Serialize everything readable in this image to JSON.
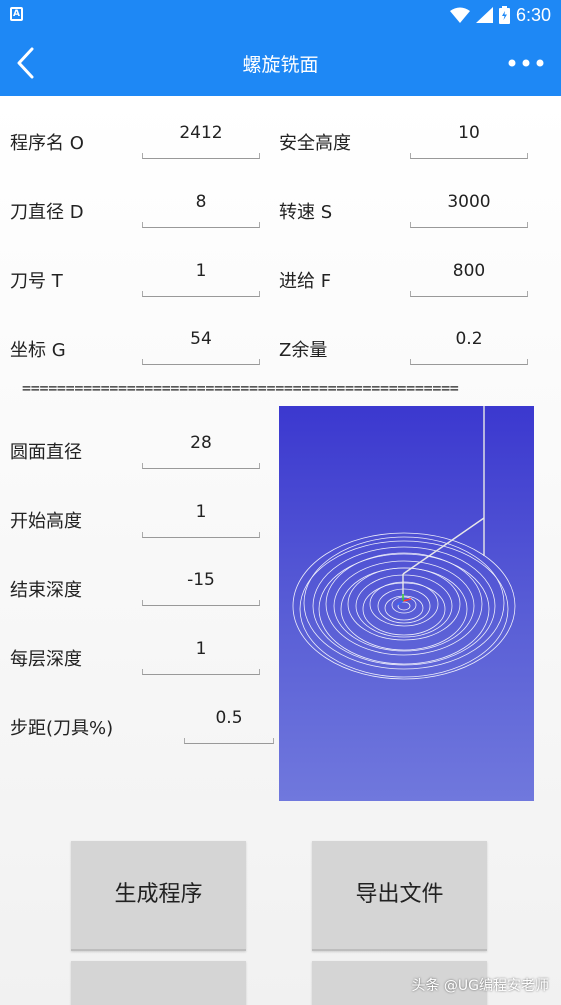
{
  "status": {
    "time": "6:30",
    "left_badge": "A"
  },
  "appbar": {
    "title": "螺旋铣面"
  },
  "params": {
    "program_name": {
      "label": "程序名 O",
      "value": "2412"
    },
    "safe_height": {
      "label": "安全高度",
      "value": "10"
    },
    "tool_diameter": {
      "label": "刀直径 D",
      "value": "8"
    },
    "spindle_speed": {
      "label": "转速 S",
      "value": "3000"
    },
    "tool_number": {
      "label": "刀号 T",
      "value": "1"
    },
    "feed": {
      "label": "进给 F",
      "value": "800"
    },
    "coordinate": {
      "label": "坐标 G",
      "value": "54"
    },
    "z_allowance": {
      "label": "Z余量",
      "value": "0.2"
    }
  },
  "divider": "==================================================",
  "circle": {
    "diameter": {
      "label": "圆面直径",
      "value": "28"
    },
    "start_height": {
      "label": "开始高度",
      "value": "1"
    },
    "end_depth": {
      "label": "结束深度",
      "value": "-15"
    },
    "layer_depth": {
      "label": "每层深度",
      "value": "1"
    },
    "step": {
      "label": "步距(刀具%)",
      "value": "0.5"
    }
  },
  "buttons": {
    "generate": "生成程序",
    "export": "导出文件"
  },
  "watermark": "头条 @UG编程安老师",
  "colors": {
    "appbar": "#1e88f5",
    "preview_top": "#3b38cf",
    "preview_bottom": "#7078dd"
  }
}
